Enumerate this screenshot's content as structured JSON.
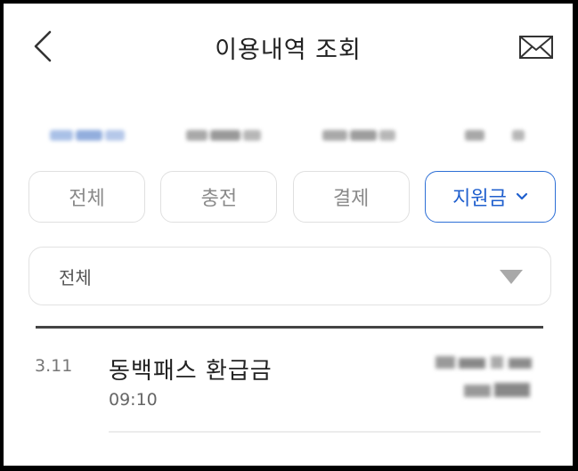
{
  "header": {
    "title": "이용내역 조회"
  },
  "tabs": [
    {
      "label": "전체",
      "active": false
    },
    {
      "label": "충전",
      "active": false
    },
    {
      "label": "결제",
      "active": false
    },
    {
      "label": "지원금",
      "active": true
    }
  ],
  "filter_select": {
    "value": "전체"
  },
  "transactions": [
    {
      "date": "3.11",
      "title": "동백패스 환급금",
      "time": "09:10"
    }
  ],
  "colors": {
    "accent": "#2d6fd6",
    "border": "#e0e0e0",
    "divider": "#444444"
  }
}
